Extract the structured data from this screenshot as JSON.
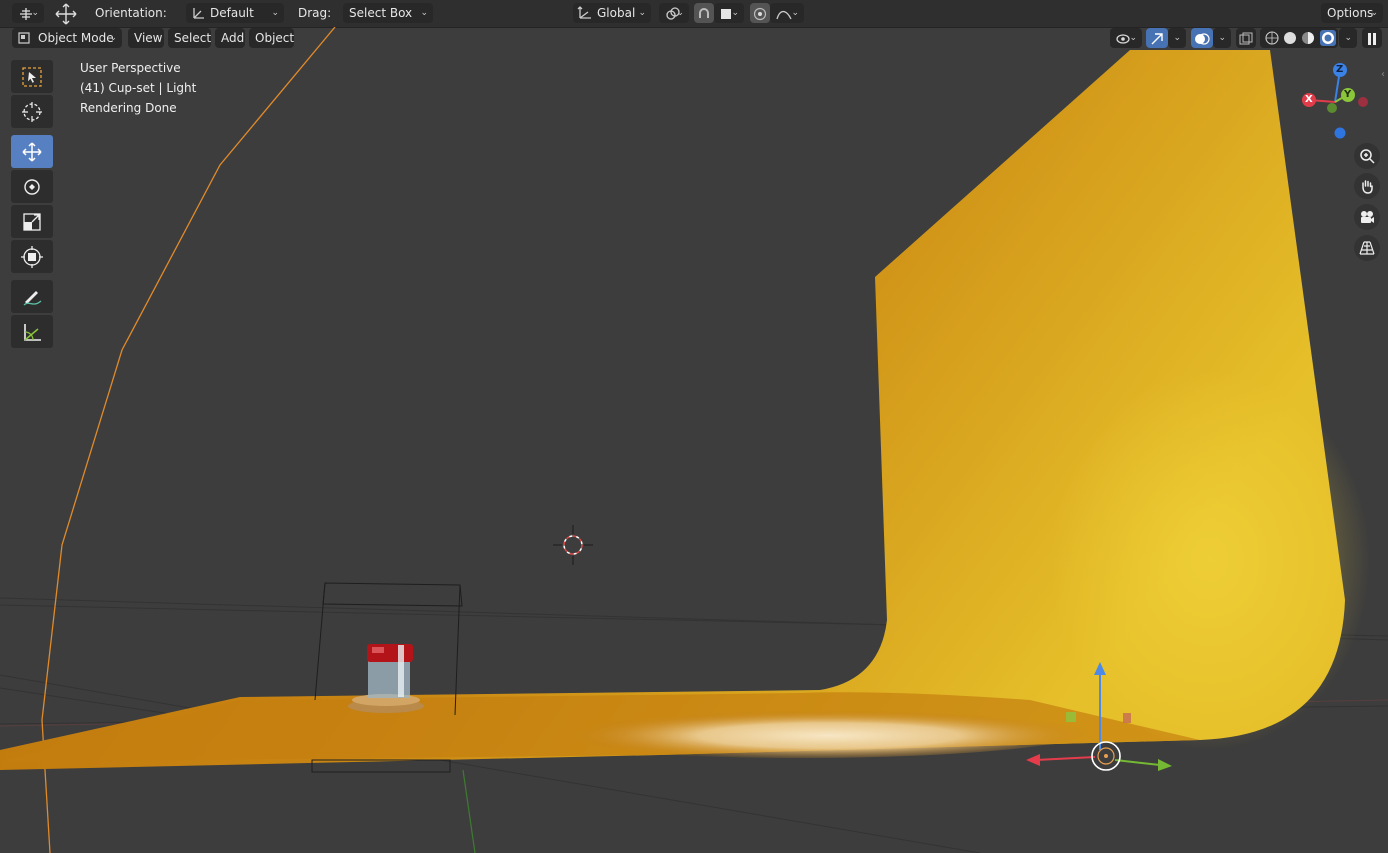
{
  "topbar": {
    "orientation_label": "Orientation:",
    "orientation_value": "Default",
    "drag_label": "Drag:",
    "drag_value": "Select Box",
    "transform_space": "Global",
    "options_label": "Options"
  },
  "header": {
    "mode": "Object Mode",
    "menus": [
      "View",
      "Select",
      "Add",
      "Object"
    ]
  },
  "overlay": {
    "perspective": "User Perspective",
    "collection": "(41) Cup-set | Light",
    "status": "Rendering Done"
  },
  "gizmo": {
    "axes": {
      "x": "X",
      "y": "Y",
      "z": "Z"
    }
  },
  "colors": {
    "accent": "#4772b3",
    "backdrop_dark": "#b86d08",
    "backdrop_light": "#e6c02a",
    "axis_x": "#e23c4a",
    "axis_y": "#8bc53a",
    "axis_z": "#3b82e6"
  },
  "tools": [
    "select-box-icon",
    "cursor-icon",
    "move-icon",
    "rotate-icon",
    "scale-icon",
    "transform-icon",
    "annotate-icon",
    "measure-icon"
  ]
}
